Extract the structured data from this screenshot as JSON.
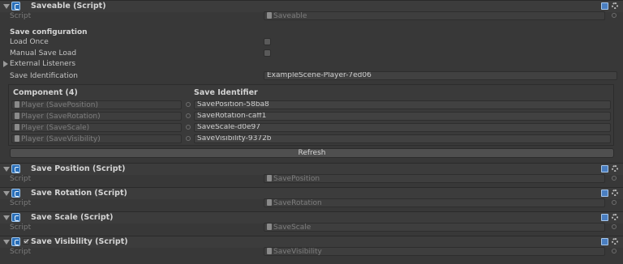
{
  "saveable": {
    "title": "Saveable (Script)",
    "script_label": "Script",
    "script_value": "Saveable",
    "section_title": "Save configuration",
    "load_once_label": "Load Once",
    "manual_save_load_label": "Manual Save Load",
    "external_listeners_label": "External Listeners",
    "save_identification_label": "Save Identification",
    "save_identification_value": "ExampleScene-Player-7ed06",
    "table": {
      "component_header": "Component (4)",
      "identifier_header": "Save Identifier",
      "rows": [
        {
          "component": "Player (SavePosition)",
          "identifier": "SavePosition-58ba8"
        },
        {
          "component": "Player (SaveRotation)",
          "identifier": "SaveRotation-caff1"
        },
        {
          "component": "Player (SaveScale)",
          "identifier": "SaveScale-d0e97"
        },
        {
          "component": "Player (SaveVisibility)",
          "identifier": "SaveVisibility-9372b"
        }
      ]
    },
    "refresh_label": "Refresh"
  },
  "components": [
    {
      "title": "Save Position (Script)",
      "script_label": "Script",
      "script_value": "SavePosition"
    },
    {
      "title": "Save Rotation (Script)",
      "script_label": "Script",
      "script_value": "SaveRotation"
    },
    {
      "title": "Save Scale (Script)",
      "script_label": "Script",
      "script_value": "SaveScale"
    },
    {
      "title": "Save Visibility (Script)",
      "script_label": "Script",
      "script_value": "SaveVisibility",
      "enabled": true
    }
  ],
  "icons": {
    "fold": "foldout-arrow-icon",
    "script": "csharp-script-icon",
    "help": "help-book-icon",
    "settings": "gear-icon",
    "object_picker": "object-picker-icon"
  },
  "colors": {
    "background": "#383838",
    "header": "#3c3c3c",
    "field": "#414141",
    "script_icon": "#2a6fb8"
  }
}
